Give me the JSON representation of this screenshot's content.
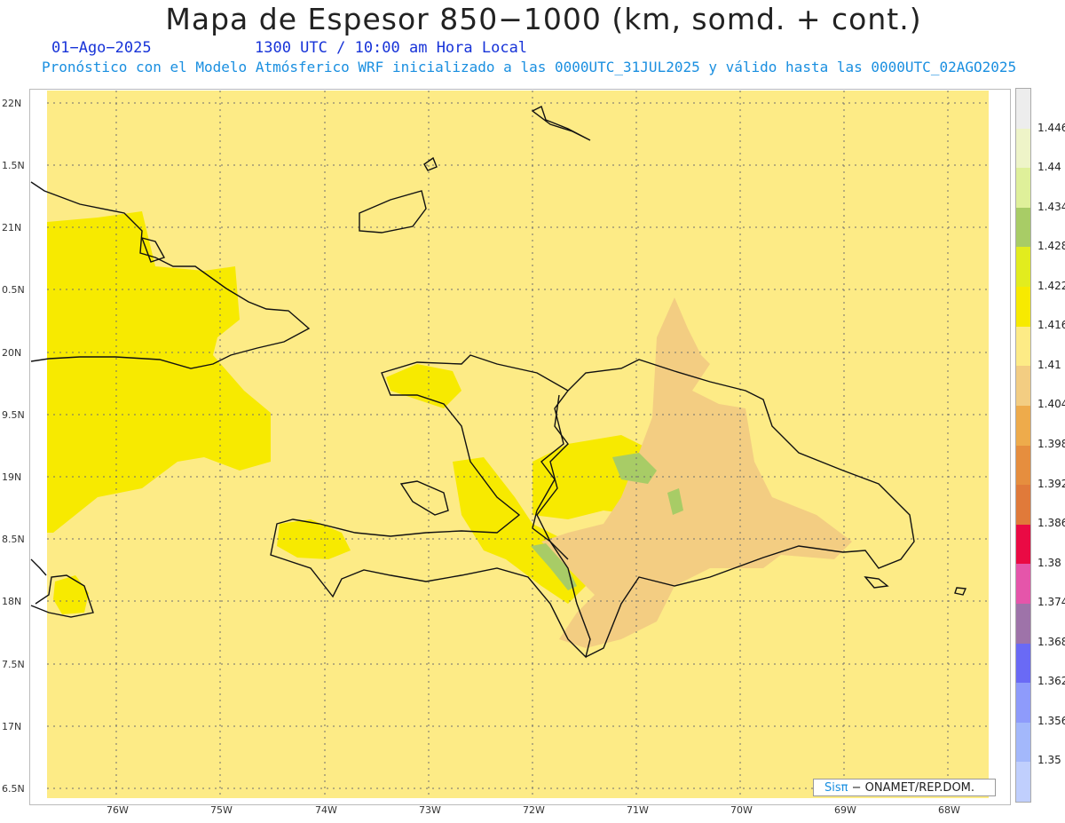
{
  "title": "Mapa de Espesor 850−1000 (km, somd. + cont.)",
  "date_label": "01−Ago−2025",
  "time_label": "1300 UTC / 10:00 am Hora Local",
  "forecast_label": "Pronóstico con el Modelo Atmósferico WRF inicializado a las 0000UTC_31JUL2025 y válido hasta las  0000UTC_02AGO2025",
  "lat_labels": [
    "22N",
    "1.5N",
    "21N",
    "0.5N",
    "20N",
    "9.5N",
    "19N",
    "8.5N",
    "18N",
    "7.5N",
    "17N",
    "6.5N"
  ],
  "lon_labels": [
    "76W",
    "75W",
    "74W",
    "73W",
    "72W",
    "71W",
    "70W",
    "69W",
    "68W"
  ],
  "colorbar": {
    "labels": [
      "1.446",
      "1.44",
      "1.434",
      "1.428",
      "1.422",
      "1.416",
      "1.41",
      "1.404",
      "1.398",
      "1.392",
      "1.386",
      "1.38",
      "1.374",
      "1.368",
      "1.362",
      "1.356",
      "1.35"
    ],
    "colors": [
      "#ededed",
      "#eef4c8",
      "#dff09a",
      "#a8cc66",
      "#e2ec1e",
      "#f7ea00",
      "#fdeb86",
      "#f3cd82",
      "#eeab4b",
      "#e68e3e",
      "#e07a3a",
      "#ea0a44",
      "#e555aa",
      "#9e73a9",
      "#6a6af5",
      "#8e9bfb",
      "#a3b8fb",
      "#c0cffd"
    ]
  },
  "credit": {
    "logo": "Sisπ",
    "text": "− ONAMET/REP.DOM."
  },
  "colors": {
    "base": "#fdeb86",
    "yellow": "#f7ea00",
    "tan": "#f3cd82",
    "green": "#a8cc66"
  }
}
